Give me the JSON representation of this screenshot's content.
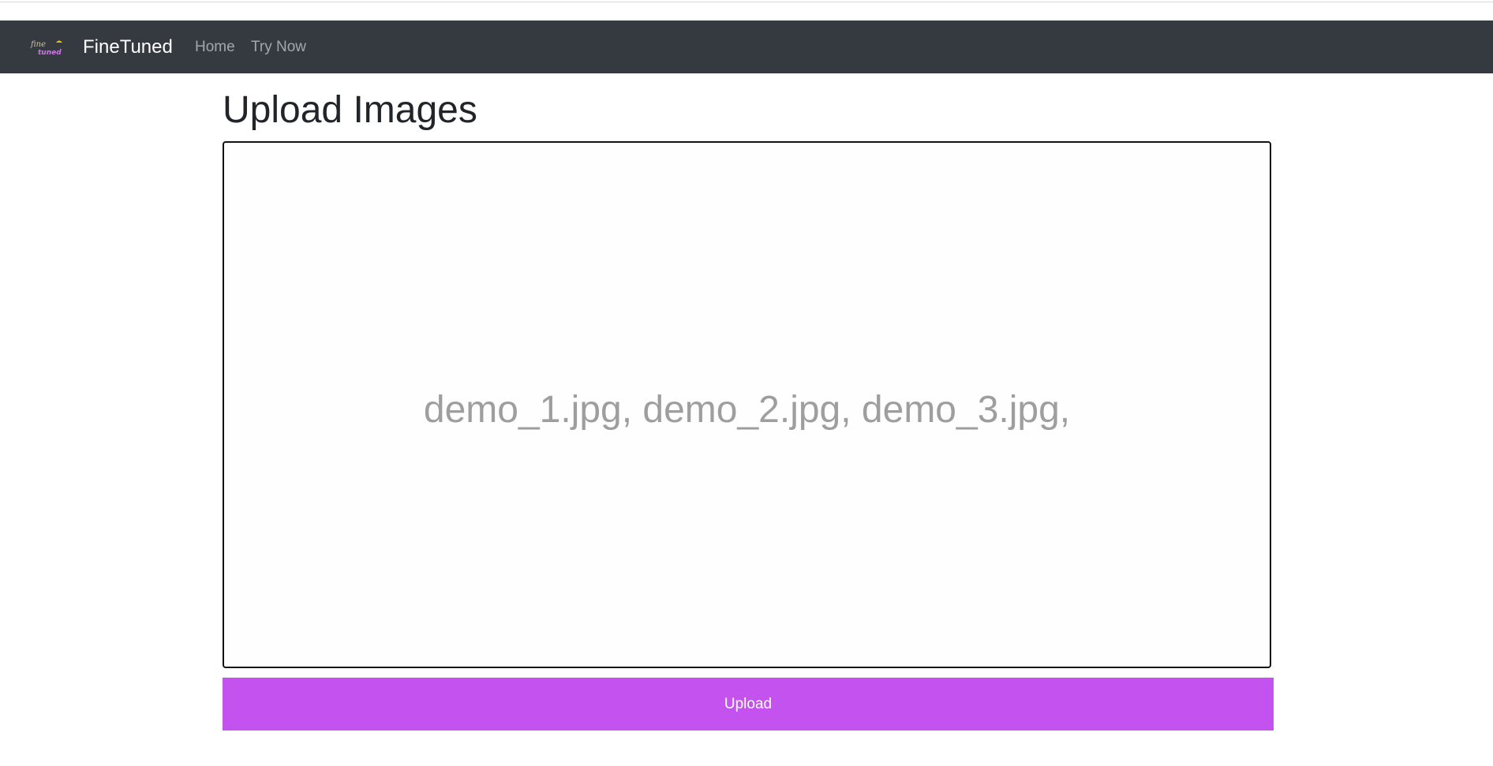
{
  "navbar": {
    "brand_name": "FineTuned",
    "links": [
      {
        "label": "Home"
      },
      {
        "label": "Try Now"
      }
    ],
    "background": "#343a40"
  },
  "main": {
    "title": "Upload Images",
    "file_drop": {
      "files_text": "demo_1.jpg, demo_2.jpg, demo_3.jpg,"
    },
    "upload_button": {
      "label": "Upload",
      "color": "#c352ee"
    }
  }
}
